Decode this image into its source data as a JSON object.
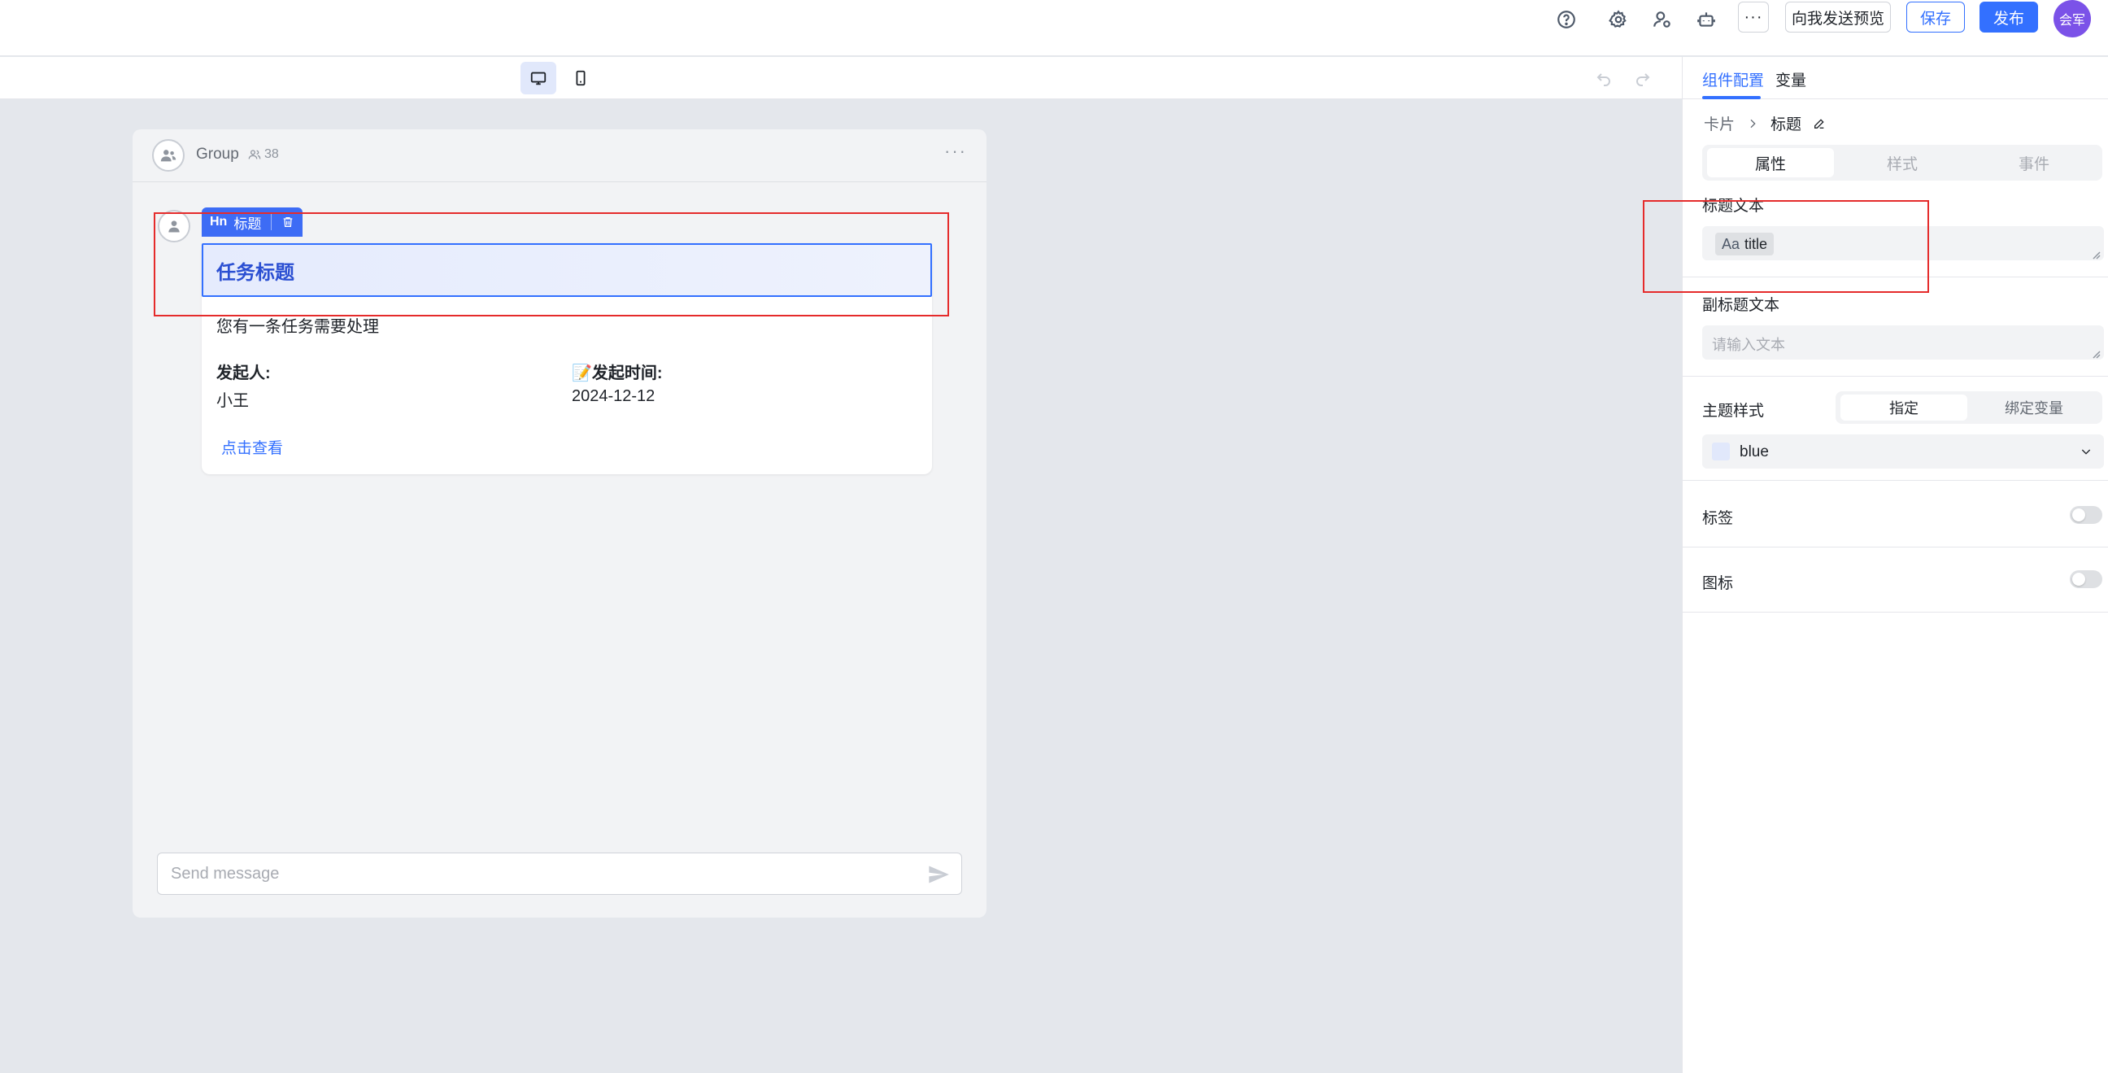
{
  "topbar": {
    "help_icon": "question-circle-icon",
    "settings_icon": "gear-icon",
    "user_icon": "user-settings-icon",
    "bot_icon": "robot-icon",
    "more_label": "···",
    "preview_label": "向我发送预览",
    "save_label": "保存",
    "publish_label": "发布",
    "avatar_text": "会军"
  },
  "editor_toolbar": {
    "devices": [
      "desktop-icon",
      "mobile-icon"
    ],
    "undo_icon": "undo-icon",
    "redo_icon": "redo-icon"
  },
  "chat": {
    "group_name": "Group",
    "member_count": "38",
    "more_label": "···",
    "input_placeholder": "Send message"
  },
  "card": {
    "tag_label": "标题",
    "tag_mark": "Hn",
    "title": "任务标题",
    "subtitle": "您有一条任务需要处理",
    "fields": [
      {
        "label": "发起人:",
        "value": "小王"
      },
      {
        "label": "📝发起时间:",
        "value": "2024-12-12"
      }
    ],
    "link": "点击查看"
  },
  "panel": {
    "tabs": [
      "组件配置",
      "变量"
    ],
    "breadcrumb": {
      "parent": "卡片",
      "current": "标题"
    },
    "segments": [
      "属性",
      "样式",
      "事件"
    ],
    "title_text_label": "标题文本",
    "title_var_chip": "title",
    "title_var_prefix": "Aa",
    "subtitle_label": "副标题文本",
    "subtitle_placeholder": "请输入文本",
    "theme_label": "主题样式",
    "theme_modes": [
      "指定",
      "绑定变量"
    ],
    "theme_value": "blue",
    "tag_label": "标签",
    "icon_label": "图标"
  },
  "colors": {
    "accent": "#3370ff",
    "annotation": "#e52b2b",
    "avatar": "#7b52e8"
  }
}
